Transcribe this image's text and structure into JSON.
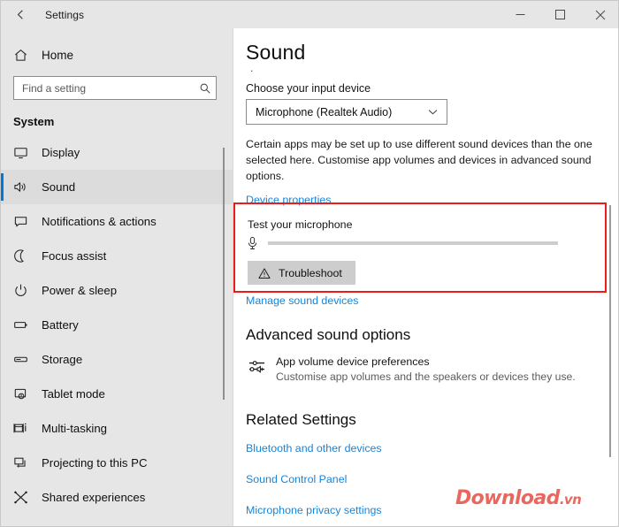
{
  "window": {
    "title": "Settings",
    "back_icon": "back-arrow-icon",
    "minimize_label": "–",
    "maximize_label": "□",
    "close_label": "✕"
  },
  "sidebar": {
    "home": {
      "label": "Home",
      "icon": "home-icon"
    },
    "search": {
      "value": "",
      "placeholder": "Find a setting",
      "icon": "search-icon"
    },
    "group_title": "System",
    "items": [
      {
        "label": "Display",
        "icon": "monitor-icon",
        "selected": false
      },
      {
        "label": "Sound",
        "icon": "speaker-icon",
        "selected": true
      },
      {
        "label": "Notifications & actions",
        "icon": "notification-icon",
        "selected": false
      },
      {
        "label": "Focus assist",
        "icon": "moon-icon",
        "selected": false
      },
      {
        "label": "Power & sleep",
        "icon": "power-icon",
        "selected": false
      },
      {
        "label": "Battery",
        "icon": "battery-icon",
        "selected": false
      },
      {
        "label": "Storage",
        "icon": "storage-icon",
        "selected": false
      },
      {
        "label": "Tablet mode",
        "icon": "tablet-icon",
        "selected": false
      },
      {
        "label": "Multi-tasking",
        "icon": "multitask-icon",
        "selected": false
      },
      {
        "label": "Projecting to this PC",
        "icon": "project-icon",
        "selected": false
      },
      {
        "label": "Shared experiences",
        "icon": "share-icon",
        "selected": false
      }
    ]
  },
  "main": {
    "title": "Sound",
    "subtitle_dot": ".",
    "input_section": {
      "label": "Choose your input device",
      "selected_device": "Microphone (Realtek Audio)",
      "chevron_icon": "chevron-down-icon"
    },
    "description": "Certain apps may be set up to use different sound devices than the one selected here. Customise app volumes and devices in advanced sound options.",
    "device_properties_link": "Device properties",
    "test_section": {
      "label": "Test your microphone",
      "mic_icon": "microphone-icon",
      "level": 0,
      "troubleshoot_label": "Troubleshoot",
      "troubleshoot_icon": "warning-triangle-icon"
    },
    "manage_devices_link": "Manage sound devices",
    "advanced": {
      "heading": "Advanced sound options",
      "option_icon": "mixer-icon",
      "option_title": "App volume  device preferences",
      "option_desc": "Customise app volumes and the speakers or devices they use."
    },
    "related": {
      "heading": "Related Settings",
      "links": [
        "Bluetooth and other devices",
        "Sound Control Panel",
        "Microphone privacy settings"
      ]
    }
  },
  "watermark": {
    "name": "Download",
    "suffix": ".vn"
  },
  "colors": {
    "accent": "#0078d7",
    "link": "#1a84d6",
    "highlight_box": "#ee1b1b",
    "chrome": "#e6e6e6",
    "watermark": "#e8685f"
  }
}
